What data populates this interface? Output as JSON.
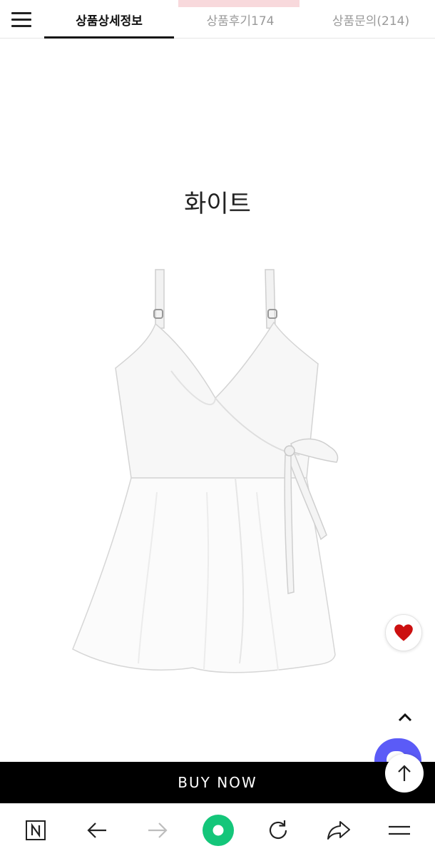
{
  "tabs": [
    {
      "label": "상품상세정보",
      "active": true
    },
    {
      "label": "상품후기174",
      "active": false
    },
    {
      "label": "상품문의(214)",
      "active": false
    }
  ],
  "content": {
    "color_name": "화이트"
  },
  "buy_bar": {
    "label": "BUY NOW"
  },
  "icons": {
    "menu": "hamburger-icon",
    "wish": "heart-icon",
    "scroll_up": "chevron-up-icon",
    "chat": "chat-icon",
    "top": "arrow-up-icon",
    "naver": "naver-n-icon",
    "back": "arrow-left-icon",
    "forward": "arrow-right-icon",
    "green": "green-dot-icon",
    "reload": "reload-icon",
    "share": "share-icon",
    "browser_menu": "menu-icon"
  },
  "colors": {
    "heart": "#cc1010",
    "chat": "#5b5bf7",
    "buy_bar": "#000000",
    "green_button": "#14c67a",
    "active_tab_underline": "#111111"
  }
}
